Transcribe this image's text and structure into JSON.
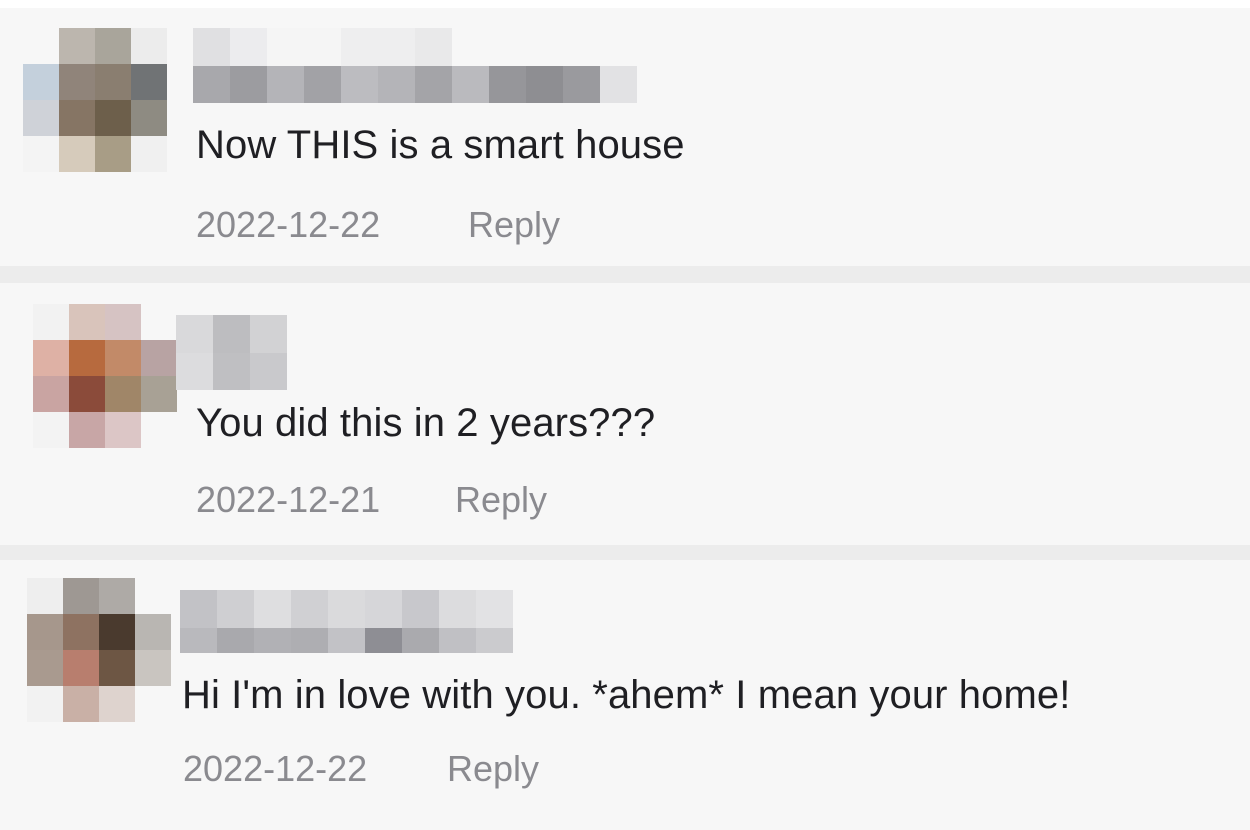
{
  "comments": [
    {
      "text": "Now THIS is a smart house",
      "date": "2022-12-22",
      "reply_label": "Reply",
      "avatar_colors": [
        "#f7f7f7",
        "#bcb6ae",
        "#a9a59b",
        "#ececec",
        "#c4d0dc",
        "#90847a",
        "#8a7e70",
        "#707375",
        "#cfd2d8",
        "#867564",
        "#6d5f4b",
        "#8e8b82",
        "#f4f4f4",
        "#d6cbbb",
        "#a89d86",
        "#f0f0f0"
      ],
      "username_colors": [
        "#e0e0e2",
        "#ececee",
        "#f5f5f5",
        "#f5f5f5",
        "#eeeeef",
        "#eeeeef",
        "#e9e9ea",
        "#f7f7f7",
        "#f7f7f7",
        "#f7f7f7",
        "#f7f7f7",
        "#f7f7f7",
        "#a8a8ac",
        "#9c9ca0",
        "#b4b4b8",
        "#a2a2a6",
        "#bcbcc0",
        "#b4b4b8",
        "#a4a4a8",
        "#bababe",
        "#96969a",
        "#8e8e92",
        "#9a9a9e",
        "#e2e2e4"
      ]
    },
    {
      "text": "You did this in 2 years???",
      "date": "2022-12-21",
      "reply_label": "Reply",
      "avatar_colors": [
        "#f2f2f2",
        "#d9c4bb",
        "#d6c3c3",
        "#f7f7f7",
        "#deb1a5",
        "#b76a3e",
        "#c28a68",
        "#b8a3a3",
        "#c9a4a2",
        "#8b4b3a",
        "#a08668",
        "#a8a195",
        "#f3f3f3",
        "#c8a6a6",
        "#dcc6c6",
        "#f7f7f7"
      ],
      "username_colors": [
        "#d9d9db",
        "#bdbdc0",
        "#d2d2d4",
        "#dcdcde",
        "#bfbfc2",
        "#c9c9cc"
      ]
    },
    {
      "text": "Hi I'm in love with you. *ahem* I mean your home!",
      "date": "2022-12-22",
      "reply_label": "Reply",
      "avatar_colors": [
        "#eeeeee",
        "#9e9893",
        "#aeaaa6",
        "#f7f7f7",
        "#a6978c",
        "#8e7261",
        "#4a3a2e",
        "#b9b6b2",
        "#a99a8f",
        "#b87e6e",
        "#6d5644",
        "#c9c5c0",
        "#f2f2f2",
        "#c9b0a6",
        "#ded3ce",
        "#f7f7f7"
      ],
      "username_colors": [
        "#c2c2c6",
        "#cfcfd2",
        "#dedee0",
        "#d0d0d3",
        "#dadadc",
        "#d6d6d9",
        "#c8c8cc",
        "#dcdcde",
        "#e2e2e4",
        "#b9b9bd",
        "#a9a9ad",
        "#b1b1b5",
        "#aeaeb2",
        "#c2c2c6",
        "#8e8e94",
        "#aaaaae",
        "#c0c0c4",
        "#cbcbce"
      ]
    }
  ]
}
